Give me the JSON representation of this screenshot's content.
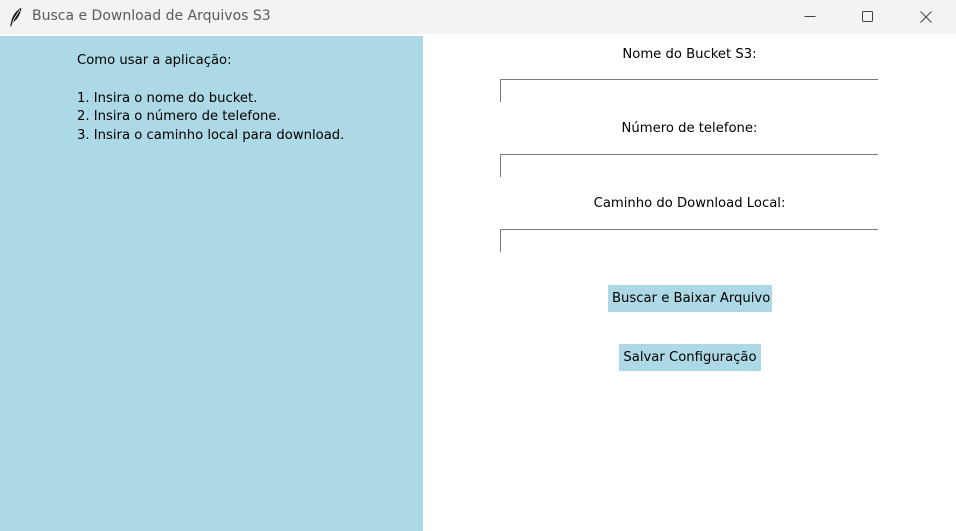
{
  "window": {
    "title": "Busca e Download de Arquivos S3",
    "icons": {
      "app": "feather-icon",
      "minimize": "minimize-icon",
      "maximize": "maximize-icon",
      "close": "close-icon"
    }
  },
  "instructions": {
    "heading": "Como usar a aplicação:",
    "steps": [
      "1. Insira o nome do bucket.",
      "2. Insira o número de telefone.",
      "3. Insira o caminho local para download."
    ]
  },
  "form": {
    "bucket": {
      "label": "Nome do Bucket S3:",
      "value": ""
    },
    "phone": {
      "label": "Número de telefone:",
      "value": ""
    },
    "path": {
      "label": "Caminho do Download Local:",
      "value": ""
    }
  },
  "buttons": {
    "search_download": "Buscar e Baixar Arquivo",
    "save_config": "Salvar Configuração"
  },
  "colors": {
    "panel": "#add8e6",
    "button": "#add8e6",
    "titlebar": "#f3f3f3"
  }
}
